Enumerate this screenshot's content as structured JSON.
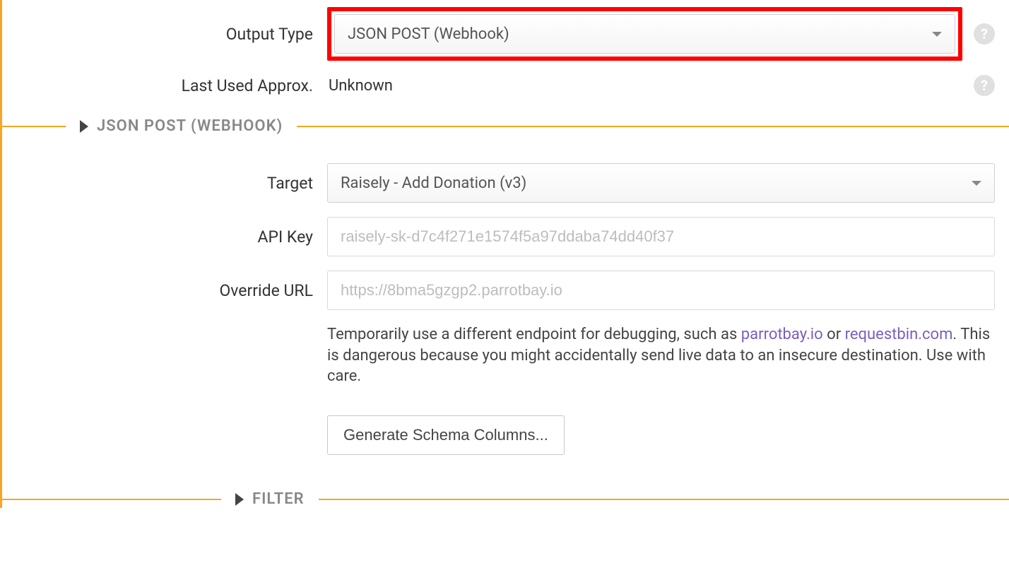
{
  "fields": {
    "output_type": {
      "label": "Output Type",
      "value": "JSON POST (Webhook)"
    },
    "last_used": {
      "label": "Last Used Approx.",
      "value": "Unknown"
    },
    "target": {
      "label": "Target",
      "value": "Raisely - Add Donation (v3)"
    },
    "api_key": {
      "label": "API Key",
      "placeholder": "raisely-sk-d7c4f271e1574f5a97ddaba74dd40f37"
    },
    "override_url": {
      "label": "Override URL",
      "placeholder": "https://8bma5gzgp2.parrotbay.io"
    }
  },
  "sections": {
    "json_post": "JSON POST (WEBHOOK)",
    "filter": "FILTER"
  },
  "hint": {
    "t1": "Temporarily use a different endpoint for debugging, such as ",
    "link1": "parrotbay.io",
    "t2": " or ",
    "link2": "requestbin.com",
    "t3": ". This is dangerous because you might accidentally send live data to an insecure destination. Use with care."
  },
  "buttons": {
    "gen_schema": "Generate Schema Columns..."
  },
  "icons": {
    "help": "?"
  }
}
